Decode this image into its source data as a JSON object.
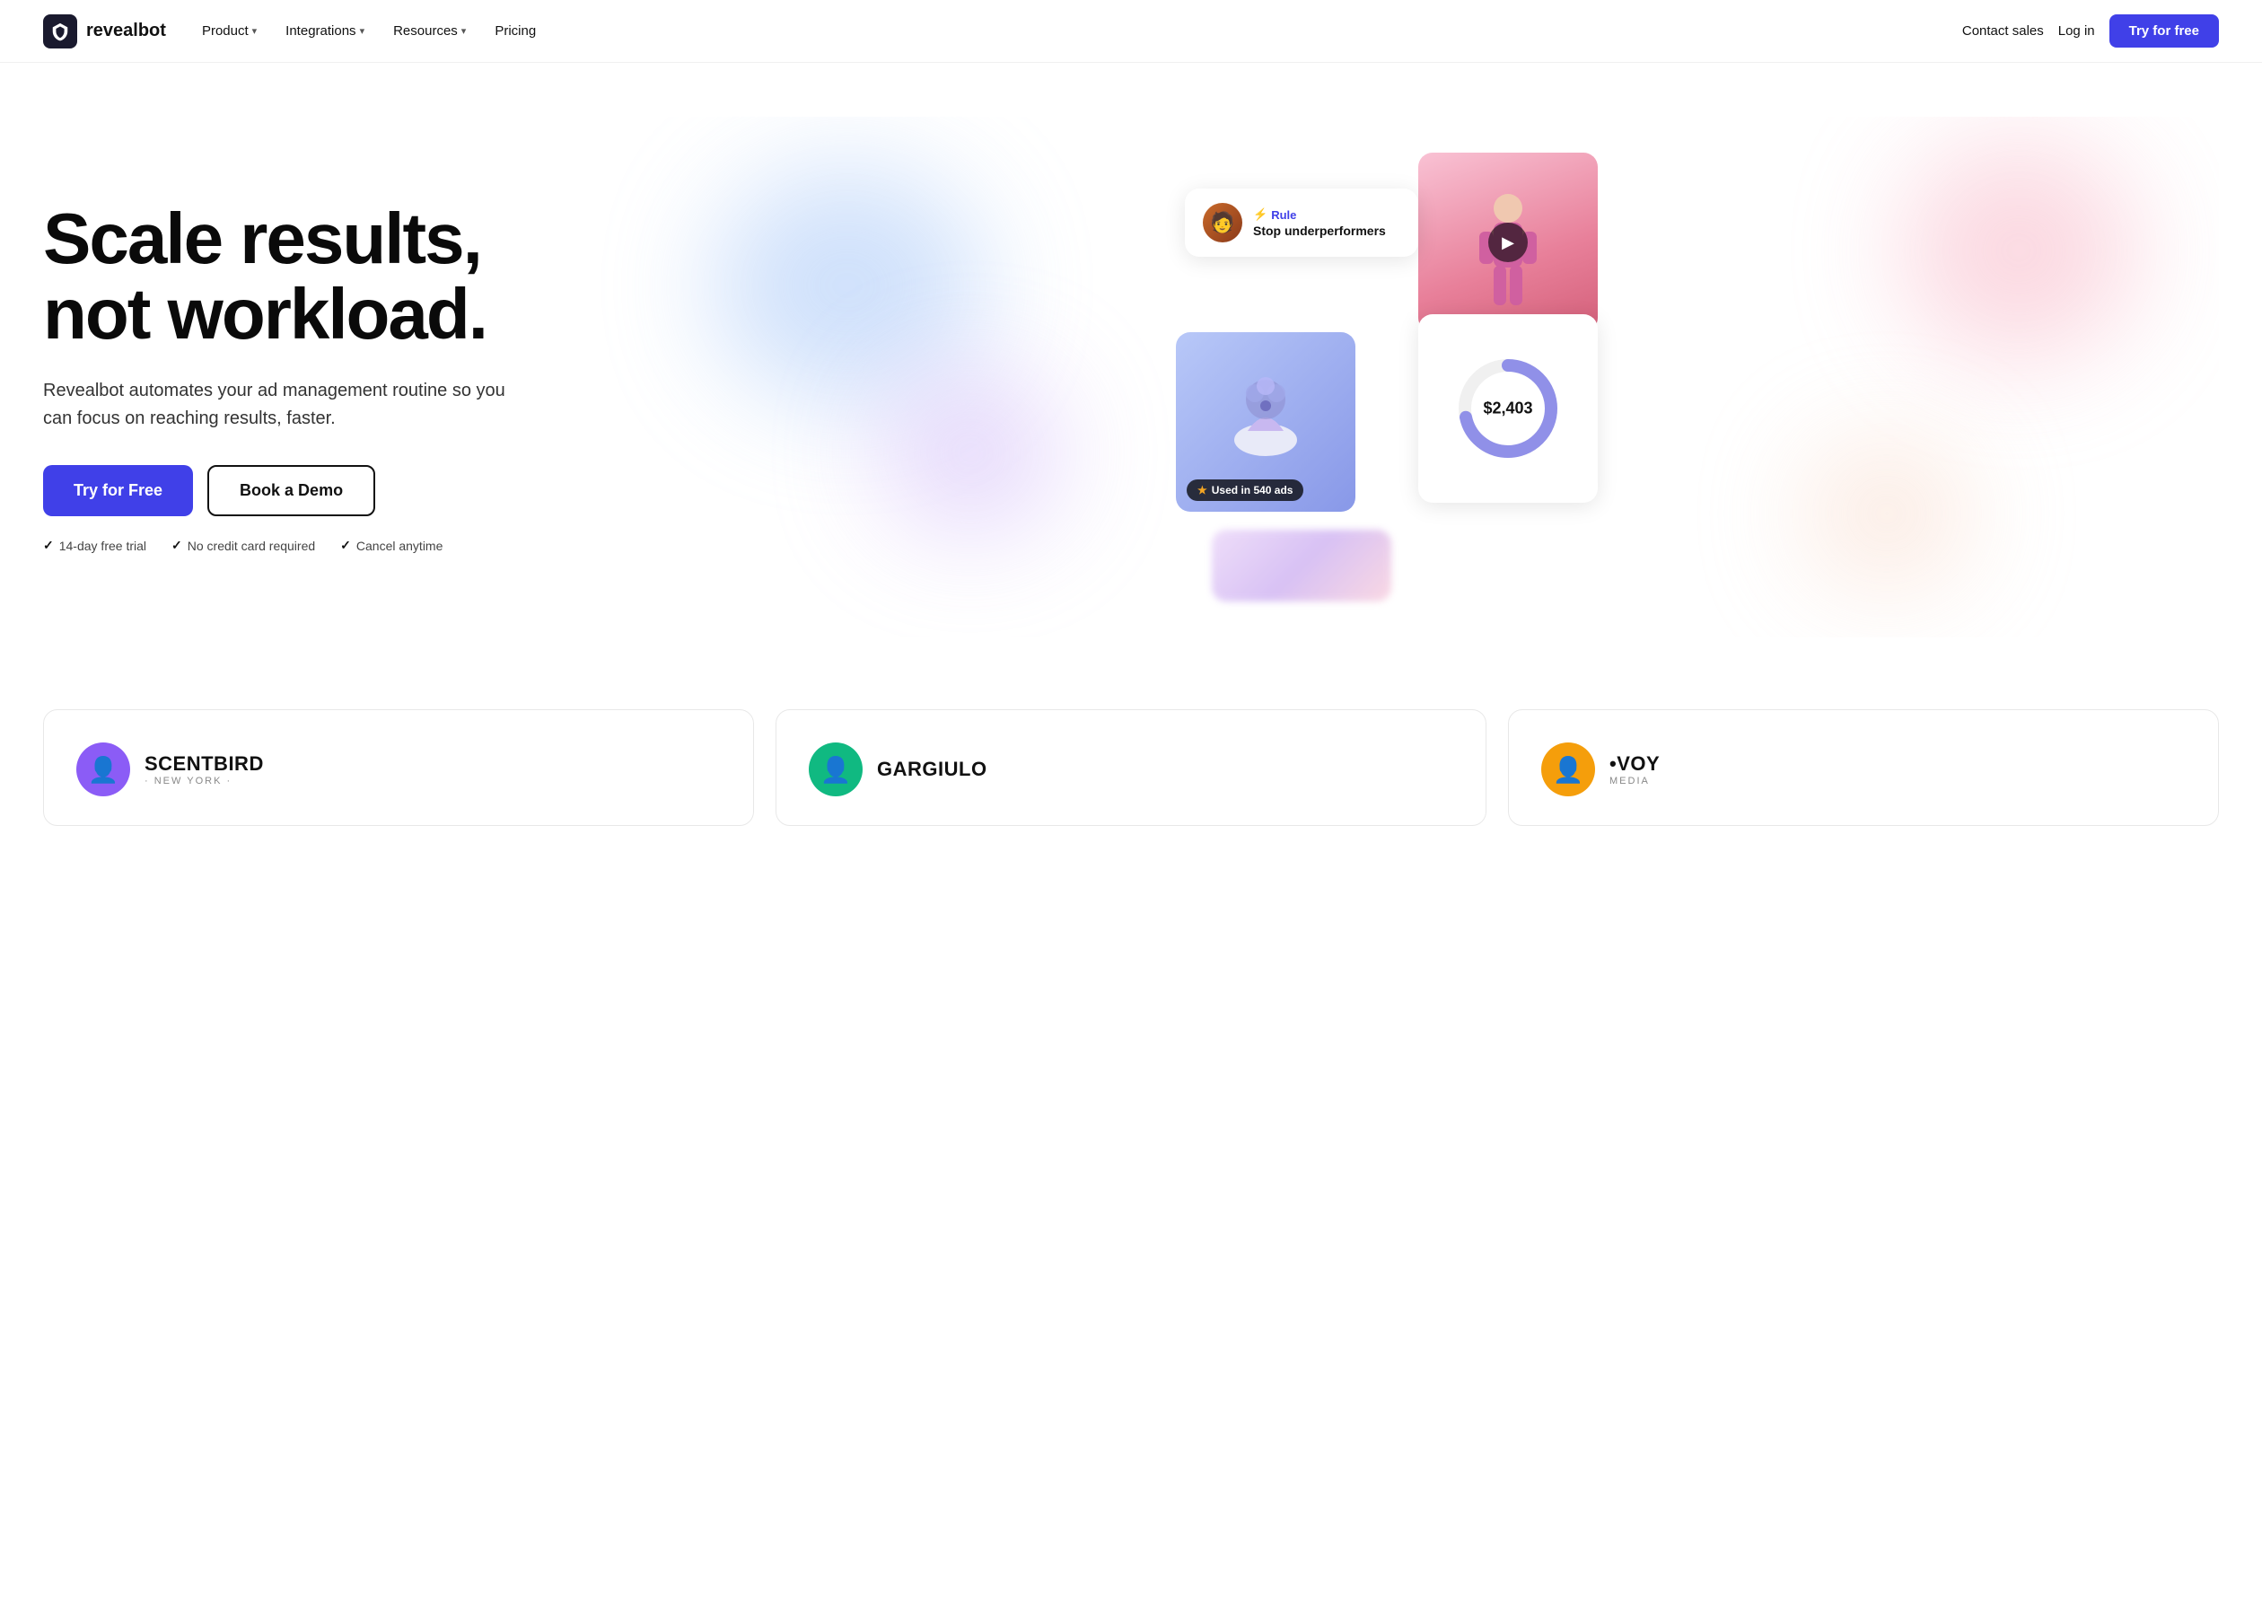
{
  "nav": {
    "logo_text": "revealbot",
    "menu_items": [
      {
        "label": "Product",
        "has_chevron": true
      },
      {
        "label": "Integrations",
        "has_chevron": true
      },
      {
        "label": "Resources",
        "has_chevron": true
      },
      {
        "label": "Pricing",
        "has_chevron": false
      }
    ],
    "contact_sales": "Contact sales",
    "login": "Log in",
    "cta": "Try for free"
  },
  "hero": {
    "headline_line1": "Scale results,",
    "headline_line2": "not workload.",
    "subtext": "Revealbot automates your ad management routine so you can focus on reaching results, faster.",
    "btn_primary": "Try for Free",
    "btn_secondary": "Book a Demo",
    "checks": [
      {
        "label": "14-day free trial"
      },
      {
        "label": "No credit card required"
      },
      {
        "label": "Cancel anytime"
      }
    ]
  },
  "hero_visual": {
    "rule_label": "Rule",
    "rule_desc": "Stop underperformers",
    "used_in_ads": "★ Used in 540 ads",
    "donut_value": "$2,403",
    "donut_pct": 72
  },
  "testimonials": [
    {
      "avatar_bg": "#8b5cf6",
      "avatar_text": "👤",
      "logo_main": "SCENTBIRD",
      "logo_sub": "· NEW YORK ·"
    },
    {
      "avatar_bg": "#10b981",
      "avatar_text": "👤",
      "logo_main": "GARGIULO",
      "logo_sub": ""
    },
    {
      "avatar_bg": "#f59e0b",
      "avatar_text": "👤",
      "logo_main": "•VOY",
      "logo_sub": "MEDIA"
    }
  ],
  "colors": {
    "brand_blue": "#4040e8",
    "white": "#ffffff",
    "dark": "#0a0a0a"
  }
}
